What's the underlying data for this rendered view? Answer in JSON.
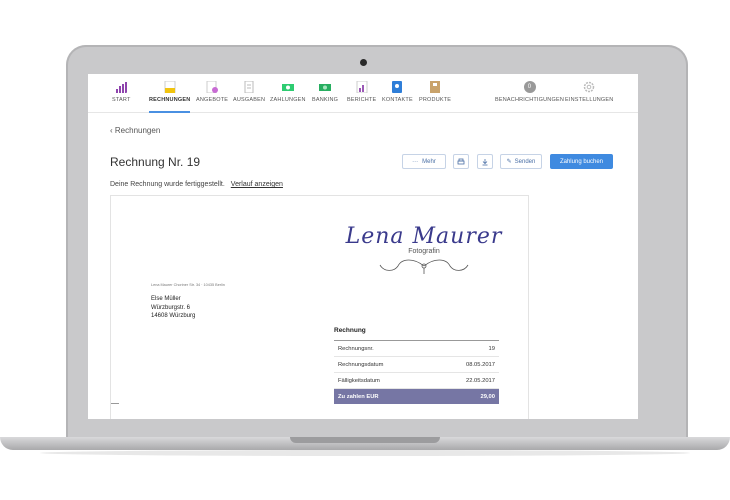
{
  "nav": {
    "items": [
      {
        "label": "START",
        "color": "#8e44ad"
      },
      {
        "label": "RECHNUNGEN",
        "color": "#f1c40f"
      },
      {
        "label": "ANGEBOTE",
        "color": "#c86bd4"
      },
      {
        "label": "AUSGABEN",
        "color": "#cfcfcf"
      },
      {
        "label": "ZAHLUNGEN",
        "color": "#2ecc71"
      },
      {
        "label": "BANKING",
        "color": "#27ae60"
      },
      {
        "label": "BERICHTE",
        "color": "#9b59b6"
      },
      {
        "label": "KONTAKTE",
        "color": "#2f7ed8"
      },
      {
        "label": "PRODUKTE",
        "color": "#c9a36b"
      }
    ],
    "notifications_label": "BENACHRICHTIGUNGEN",
    "notifications_count": "0",
    "settings_label": "EINSTELLUNGEN"
  },
  "breadcrumb": {
    "back": "Rechnungen"
  },
  "invoice": {
    "title": "Rechnung Nr. 19",
    "btn_more": "Mehr",
    "btn_send": "Senden",
    "btn_book": "Zahlung buchen",
    "info_text": "Deine Rechnung wurde fertiggestellt.",
    "info_link": "Verlauf anzeigen"
  },
  "document": {
    "logo_name": "Lena Maurer",
    "logo_sub": "Fotografin",
    "sender_line": "Lena Maurer Choriner Str. 34 · 10435 Berlin",
    "recipient": {
      "name": "Else Müller",
      "street": "Würzburgstr. 6",
      "city": "14608 Würzburg"
    },
    "table": {
      "heading": "Rechnung",
      "rows": [
        {
          "label": "Rechnungsnr.",
          "value": "19"
        },
        {
          "label": "Rechnungsdatum",
          "value": "08.05.2017"
        },
        {
          "label": "Fälligkeitsdatum",
          "value": "22.05.2017"
        }
      ],
      "total_label": "Zu zahlen EUR",
      "total_value": "29,00"
    }
  }
}
